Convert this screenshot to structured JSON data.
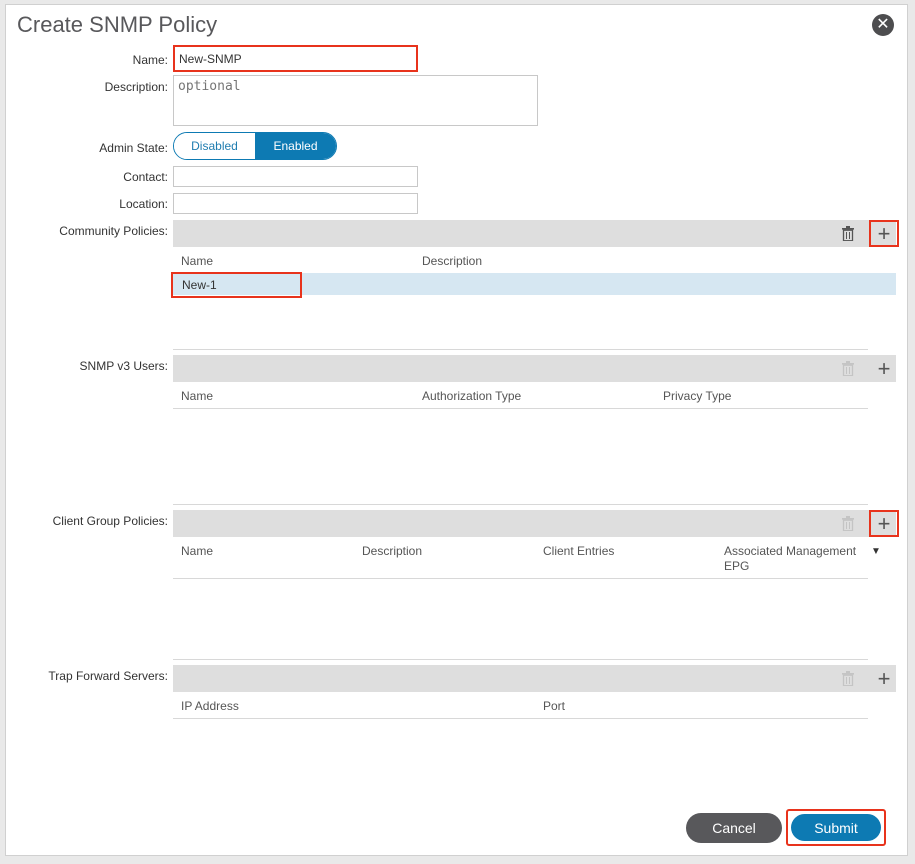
{
  "dialog": {
    "title": "Create SNMP Policy"
  },
  "form": {
    "name_label": "Name:",
    "name_value": "New-SNMP",
    "description_label": "Description:",
    "description_placeholder": "optional",
    "admin_state_label": "Admin State:",
    "admin_state_off": "Disabled",
    "admin_state_on": "Enabled",
    "contact_label": "Contact:",
    "location_label": "Location:"
  },
  "community": {
    "label": "Community Policies:",
    "columns": [
      "Name",
      "Description"
    ],
    "rows": [
      {
        "name": "New-1"
      }
    ]
  },
  "snmpv3": {
    "label": "SNMP v3 Users:",
    "columns": [
      "Name",
      "Authorization Type",
      "Privacy Type"
    ]
  },
  "client_groups": {
    "label": "Client Group Policies:",
    "columns": [
      "Name",
      "Description",
      "Client Entries",
      "Associated Management EPG"
    ]
  },
  "trap_servers": {
    "label": "Trap Forward Servers:",
    "columns": [
      "IP Address",
      "Port"
    ]
  },
  "footer": {
    "cancel": "Cancel",
    "submit": "Submit"
  },
  "colors": {
    "accent": "#0d7ab3",
    "highlight": "#e8331c"
  }
}
